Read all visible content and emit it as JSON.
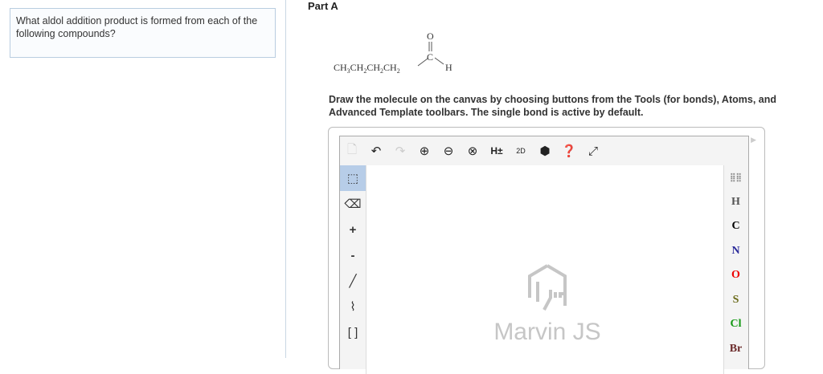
{
  "question": "What aldol addition product is formed from each of the following compounds?",
  "part_label": "Part A",
  "molecule": {
    "chain": "CH3CH2CH2CH2",
    "carbonyl_c": "C",
    "oxygen": "O",
    "hydrogen": "H"
  },
  "instructions": "Draw the molecule on the canvas by choosing buttons from the Tools (for bonds), Atoms, and Advanced Template toolbars. The single bond is active by default.",
  "toolbar": [
    "new-document",
    "undo",
    "redo",
    "zoom-in",
    "zoom-out",
    "zoom-reset",
    "H±",
    "2D",
    "info",
    "help",
    "fullscreen"
  ],
  "tools": {
    "plus": "+",
    "minus": "-"
  },
  "atoms": [
    {
      "symbol": "H",
      "color": "#555555"
    },
    {
      "symbol": "C",
      "color": "#000000"
    },
    {
      "symbol": "N",
      "color": "#2b2b9a"
    },
    {
      "symbol": "O",
      "color": "#ee0000"
    },
    {
      "symbol": "S",
      "color": "#6b6b1a"
    },
    {
      "symbol": "Cl",
      "color": "#159915"
    },
    {
      "symbol": "Br",
      "color": "#6b2a2a"
    }
  ],
  "watermark": "Marvin JS",
  "h_label": "H±",
  "clean_label": "2D"
}
